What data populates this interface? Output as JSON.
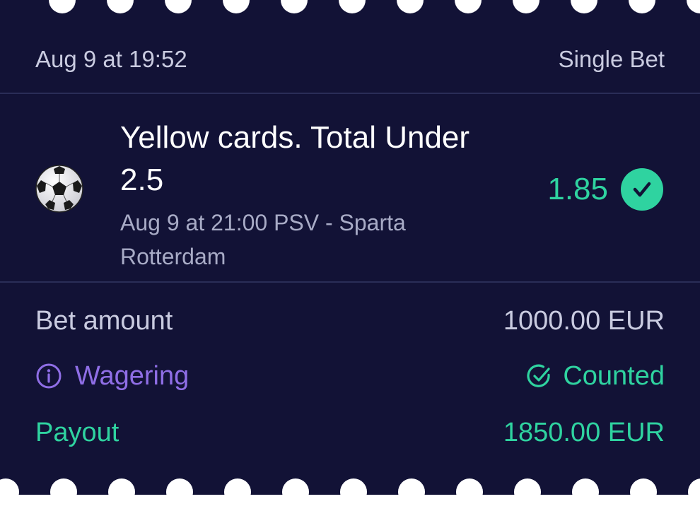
{
  "header": {
    "placed_at": "Aug 9 at 19:52",
    "bet_type": "Single Bet"
  },
  "selection": {
    "sport_icon": "soccer-ball-icon",
    "market_line1": "Yellow cards. Total Under",
    "market_line2": "2.5",
    "match_line1": "Aug 9 at 21:00 PSV - Sparta",
    "match_line2": "Rotterdam",
    "odds": "1.85",
    "status_icon": "check-circle-icon"
  },
  "details": {
    "bet_amount_label": "Bet amount",
    "bet_amount_value": "1000.00 EUR",
    "wagering_label": "Wagering",
    "wagering_value": "Counted",
    "payout_label": "Payout",
    "payout_value": "1850.00 EUR"
  },
  "colors": {
    "background": "#121236",
    "accent_green": "#2fd3a0",
    "accent_purple": "#8f6ee6",
    "text_muted": "#c9cbe0"
  }
}
